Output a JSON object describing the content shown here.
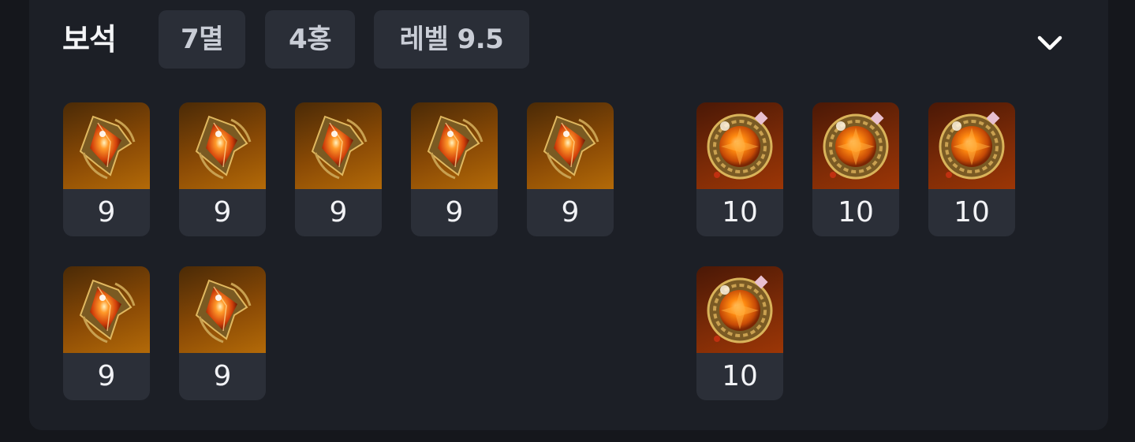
{
  "section": {
    "title": "보석",
    "badges": {
      "count": "7멸",
      "count2": "4홍",
      "level": "레벨 9.5"
    }
  },
  "gems": {
    "left": [
      {
        "level": "9",
        "icon": "orange-flame-gem-icon"
      },
      {
        "level": "9",
        "icon": "orange-flame-gem-icon"
      },
      {
        "level": "9",
        "icon": "orange-flame-gem-icon"
      },
      {
        "level": "9",
        "icon": "orange-flame-gem-icon"
      },
      {
        "level": "9",
        "icon": "orange-flame-gem-icon"
      },
      {
        "level": "9",
        "icon": "orange-flame-gem-icon"
      },
      {
        "level": "9",
        "icon": "orange-flame-gem-icon"
      }
    ],
    "right": [
      {
        "level": "10",
        "icon": "ornate-round-gem-icon"
      },
      {
        "level": "10",
        "icon": "ornate-round-gem-icon"
      },
      {
        "level": "10",
        "icon": "ornate-round-gem-icon"
      },
      {
        "level": "10",
        "icon": "ornate-round-gem-icon"
      }
    ]
  },
  "colors": {
    "panel_bg": "#1c1f26",
    "badge_bg": "#2a2e37",
    "flame_gem_bg": "#8a4a05",
    "round_gem_bg": "#7a2a07"
  }
}
